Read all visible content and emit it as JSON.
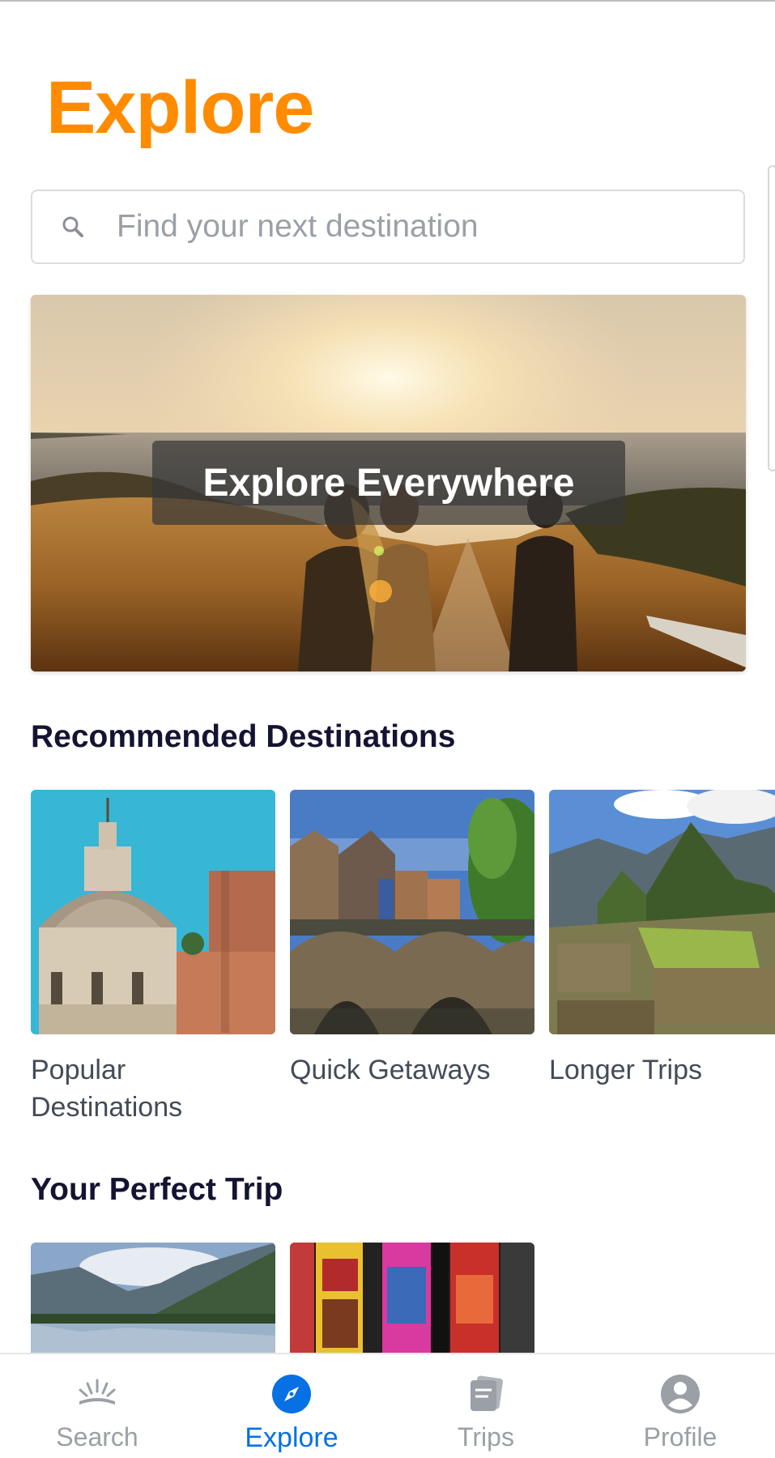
{
  "header": {
    "title": "Explore"
  },
  "search": {
    "placeholder": "Find your next destination"
  },
  "hero": {
    "label": "Explore Everywhere"
  },
  "recommended": {
    "title": "Recommended Destinations",
    "cards": [
      {
        "label": "Popular Destinations"
      },
      {
        "label": "Quick Getaways"
      },
      {
        "label": "Longer Trips"
      }
    ]
  },
  "perfect_trip": {
    "title": "Your Perfect Trip"
  },
  "bottom_nav": {
    "items": [
      {
        "label": "Search",
        "icon": "sunrise-icon",
        "active": false
      },
      {
        "label": "Explore",
        "icon": "compass-icon",
        "active": true
      },
      {
        "label": "Trips",
        "icon": "trips-icon",
        "active": false
      },
      {
        "label": "Profile",
        "icon": "profile-icon",
        "active": false
      }
    ]
  },
  "colors": {
    "accent_orange": "#ff8b00",
    "active_blue": "#0770e3",
    "inactive_gray": "#9aa0a6",
    "heading_dark": "#141432"
  }
}
